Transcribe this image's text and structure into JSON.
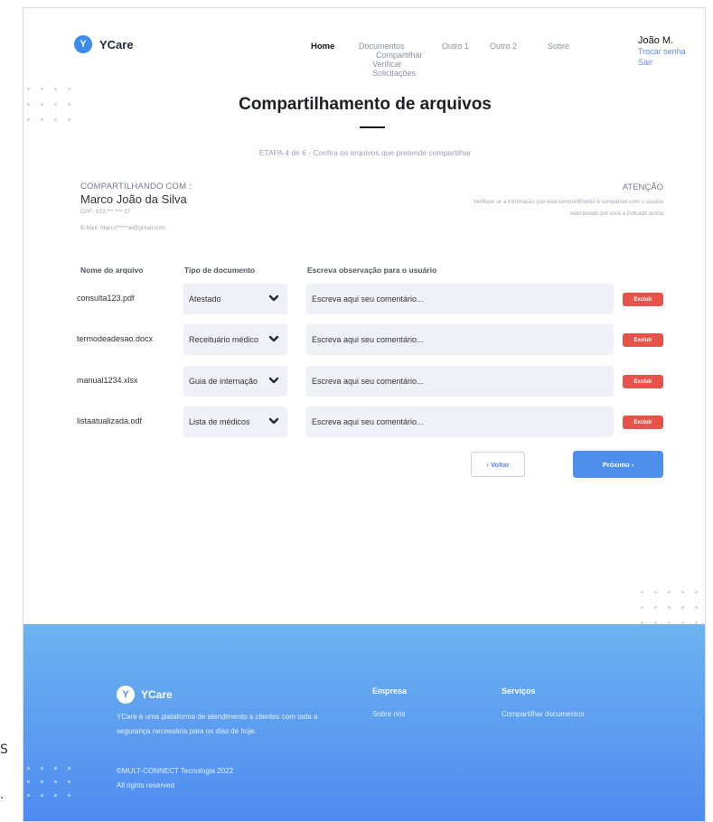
{
  "header": {
    "logo_letter": "Y",
    "logo_text": "YCare",
    "nav": {
      "home": "Home",
      "documents": "Documentos",
      "documents_sub": [
        "Compartilhar",
        "Verificar",
        "Solicitações"
      ],
      "other1": "Outro 1",
      "other2": "Outro 2",
      "about": "Sobre"
    },
    "user": {
      "name": "João M.",
      "change_password": "Trocar senha",
      "logout": "Sair"
    }
  },
  "page": {
    "title": "Compartilhamento de arquivos",
    "step": "ETAPA 4 de 6 - Confira os arquivos que pretende compartilhar"
  },
  "share": {
    "label": "COMPARTILHANDO COM :",
    "name": "Marco João da Silva",
    "cpf": "CPF: 123.***.***-17",
    "email": "E-Mail: Marco*****al@gmail.com"
  },
  "attention": {
    "title": "ATENÇÃO",
    "text": "Verifique se a informação que está compartilhando é compatível com o usuário selecionado por você e indicado acima"
  },
  "table": {
    "headers": {
      "file": "Nome do arquivo",
      "type": "Tipo de documento",
      "note": "Escreva observação para o usuário"
    },
    "comment_placeholder": "Escreva aqui seu comentário...",
    "delete_label": "Excluir",
    "rows": [
      {
        "file": "consulta123.pdf",
        "type": "Atestado"
      },
      {
        "file": "termodeadesao.docx",
        "type": "Receituário médico"
      },
      {
        "file": "manual1234.xlsx",
        "type": "Guia de internação"
      },
      {
        "file": "listaatualizada.odf",
        "type": "Lista de médicos"
      }
    ]
  },
  "actions": {
    "back": "‹ Voltar",
    "next": "Próximo ›"
  },
  "footer": {
    "logo_letter": "Y",
    "logo_text": "YCare",
    "description": "YCare é uma plataforma de atendimento a clientes com toda a segurança necessária para os dias de hoje.",
    "copyright": "©MULT-CONNECT Tecnologia 2022",
    "rights": "All rights reserved",
    "company_title": "Empresa",
    "company_link": "Sobre nós",
    "services_title": "Serviços",
    "services_link": "Compartilhar documentos"
  },
  "outside": {
    "glyph1": "S",
    "glyph2": "."
  },
  "colors": {
    "brand": "#3f8cf0",
    "delete": "#e5534b",
    "footer_gradient_top": "#6db3ef",
    "footer_gradient_bottom": "#4e8cf0"
  }
}
